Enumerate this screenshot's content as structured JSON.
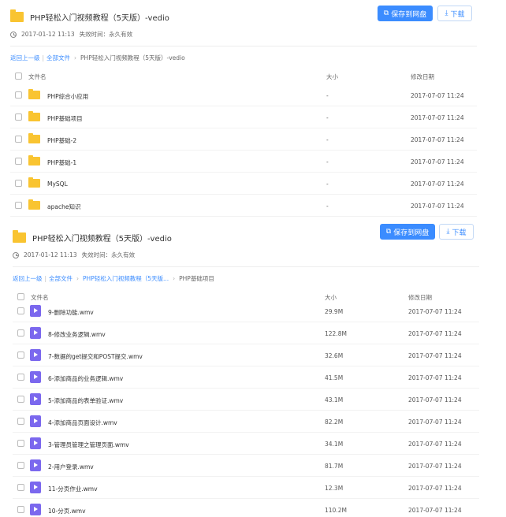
{
  "panel1": {
    "title": "PHP轻松入门视频教程（5天版）-vedio",
    "save_label": "保存到网盘",
    "download_label": "下载",
    "timestamp": "2017-01-12 11:13",
    "expiry": "失效时间：永久有效",
    "crumbs": {
      "back": "返回上一级",
      "all": "全部文件",
      "current": "PHP轻松入门视频教程（5天版）-vedio"
    },
    "headers": {
      "name": "文件名",
      "size": "大小",
      "date": "修改日期"
    },
    "rows": [
      {
        "name": "PHP综合小应用",
        "size": "-",
        "date": "2017-07-07 11:24"
      },
      {
        "name": "PHP基础项目",
        "size": "-",
        "date": "2017-07-07 11:24"
      },
      {
        "name": "PHP基础-2",
        "size": "-",
        "date": "2017-07-07 11:24"
      },
      {
        "name": "PHP基础-1",
        "size": "-",
        "date": "2017-07-07 11:24"
      },
      {
        "name": "MySQL",
        "size": "-",
        "date": "2017-07-07 11:24"
      },
      {
        "name": "apache知识",
        "size": "-",
        "date": "2017-07-07 11:24"
      }
    ]
  },
  "panel2": {
    "title": "PHP轻松入门视频教程（5天版）-vedio",
    "save_label": "保存到网盘",
    "download_label": "下载",
    "timestamp": "2017-01-12 11:13",
    "expiry": "失效时间：永久有效",
    "crumbs": {
      "back": "返回上一级",
      "all": "全部文件",
      "mid": "PHP轻松入门视频教程（5天版...",
      "current": "PHP基础项目"
    },
    "headers": {
      "name": "文件名",
      "size": "大小",
      "date": "修改日期"
    },
    "rows": [
      {
        "name": "9-删除功能.wmv",
        "size": "29.9M",
        "date": "2017-07-07 11:24"
      },
      {
        "name": "8-修改业务逻辑.wmv",
        "size": "122.8M",
        "date": "2017-07-07 11:24"
      },
      {
        "name": "7-数据的get提交和POST提交.wmv",
        "size": "32.6M",
        "date": "2017-07-07 11:24"
      },
      {
        "name": "6-添加商品的业务逻辑.wmv",
        "size": "41.5M",
        "date": "2017-07-07 11:24"
      },
      {
        "name": "5-添加商品的表单验证.wmv",
        "size": "43.1M",
        "date": "2017-07-07 11:24"
      },
      {
        "name": "4-添加商品页面设计.wmv",
        "size": "82.2M",
        "date": "2017-07-07 11:24"
      },
      {
        "name": "3-管理员管理之管理页面.wmv",
        "size": "34.1M",
        "date": "2017-07-07 11:24"
      },
      {
        "name": "2-用户登录.wmv",
        "size": "81.7M",
        "date": "2017-07-07 11:24"
      },
      {
        "name": "11-分页作业.wmv",
        "size": "12.3M",
        "date": "2017-07-07 11:24"
      },
      {
        "name": "10-分页.wmv",
        "size": "110.2M",
        "date": "2017-07-07 11:24"
      }
    ]
  }
}
